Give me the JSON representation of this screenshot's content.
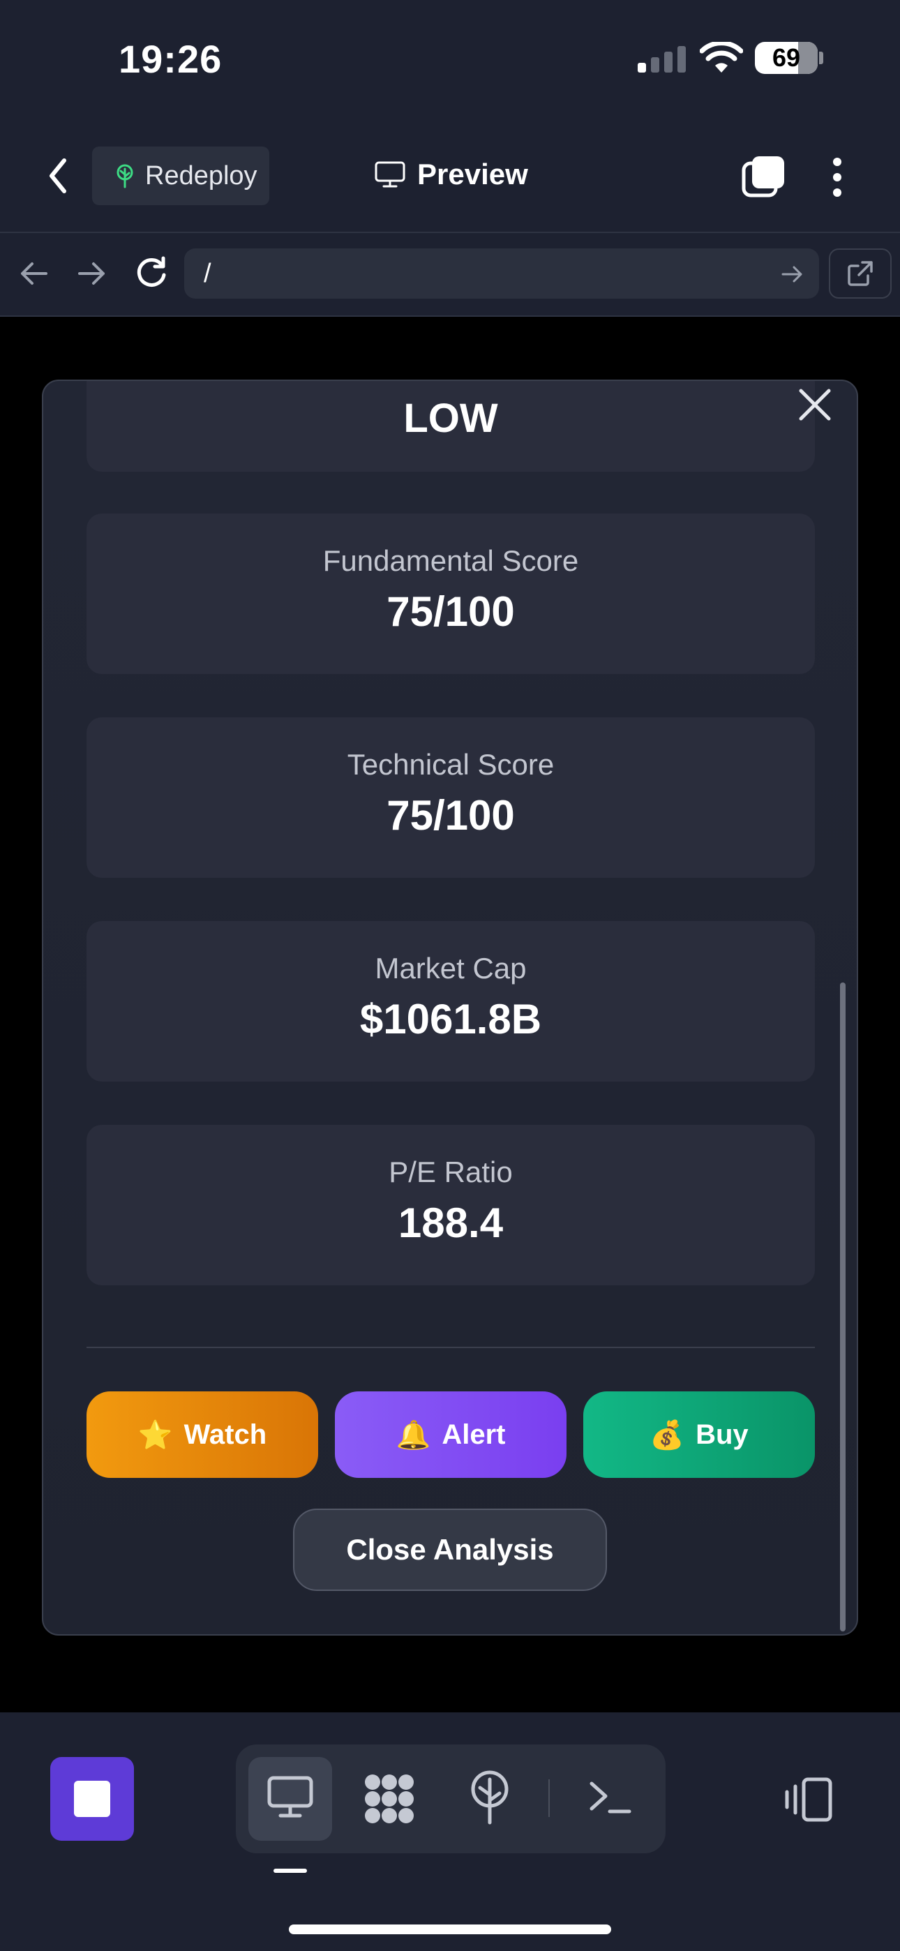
{
  "status_bar": {
    "time": "19:26",
    "battery": "69"
  },
  "toolbar": {
    "redeploy_label": "Redeploy",
    "preview_label": "Preview"
  },
  "address_bar": {
    "url": "/"
  },
  "modal": {
    "risk_value": "LOW",
    "metrics": [
      {
        "label": "Fundamental Score",
        "value": "75/100"
      },
      {
        "label": "Technical Score",
        "value": "75/100"
      },
      {
        "label": "Market Cap",
        "value": "$1061.8B"
      },
      {
        "label": "P/E Ratio",
        "value": "188.4"
      }
    ],
    "buttons": {
      "watch": {
        "emoji": "⭐",
        "label": "Watch"
      },
      "alert": {
        "emoji": "🔔",
        "label": "Alert"
      },
      "buy": {
        "emoji": "💰",
        "label": "Buy"
      }
    },
    "close_label": "Close Analysis"
  },
  "colors": {
    "background": "#1d2130",
    "watch": "#f29a0f",
    "alert": "#8a5cf6",
    "buy": "#12b886",
    "stop": "#5e3bd7"
  },
  "icons": [
    "back-chevron-icon",
    "sprout-icon",
    "monitor-icon",
    "tabs-icon",
    "more-vertical-icon",
    "arrow-left-icon",
    "arrow-right-icon",
    "refresh-icon",
    "external-link-icon",
    "close-icon",
    "stop-icon",
    "grid-icon",
    "deploy-icon",
    "terminal-icon",
    "devices-icon"
  ]
}
